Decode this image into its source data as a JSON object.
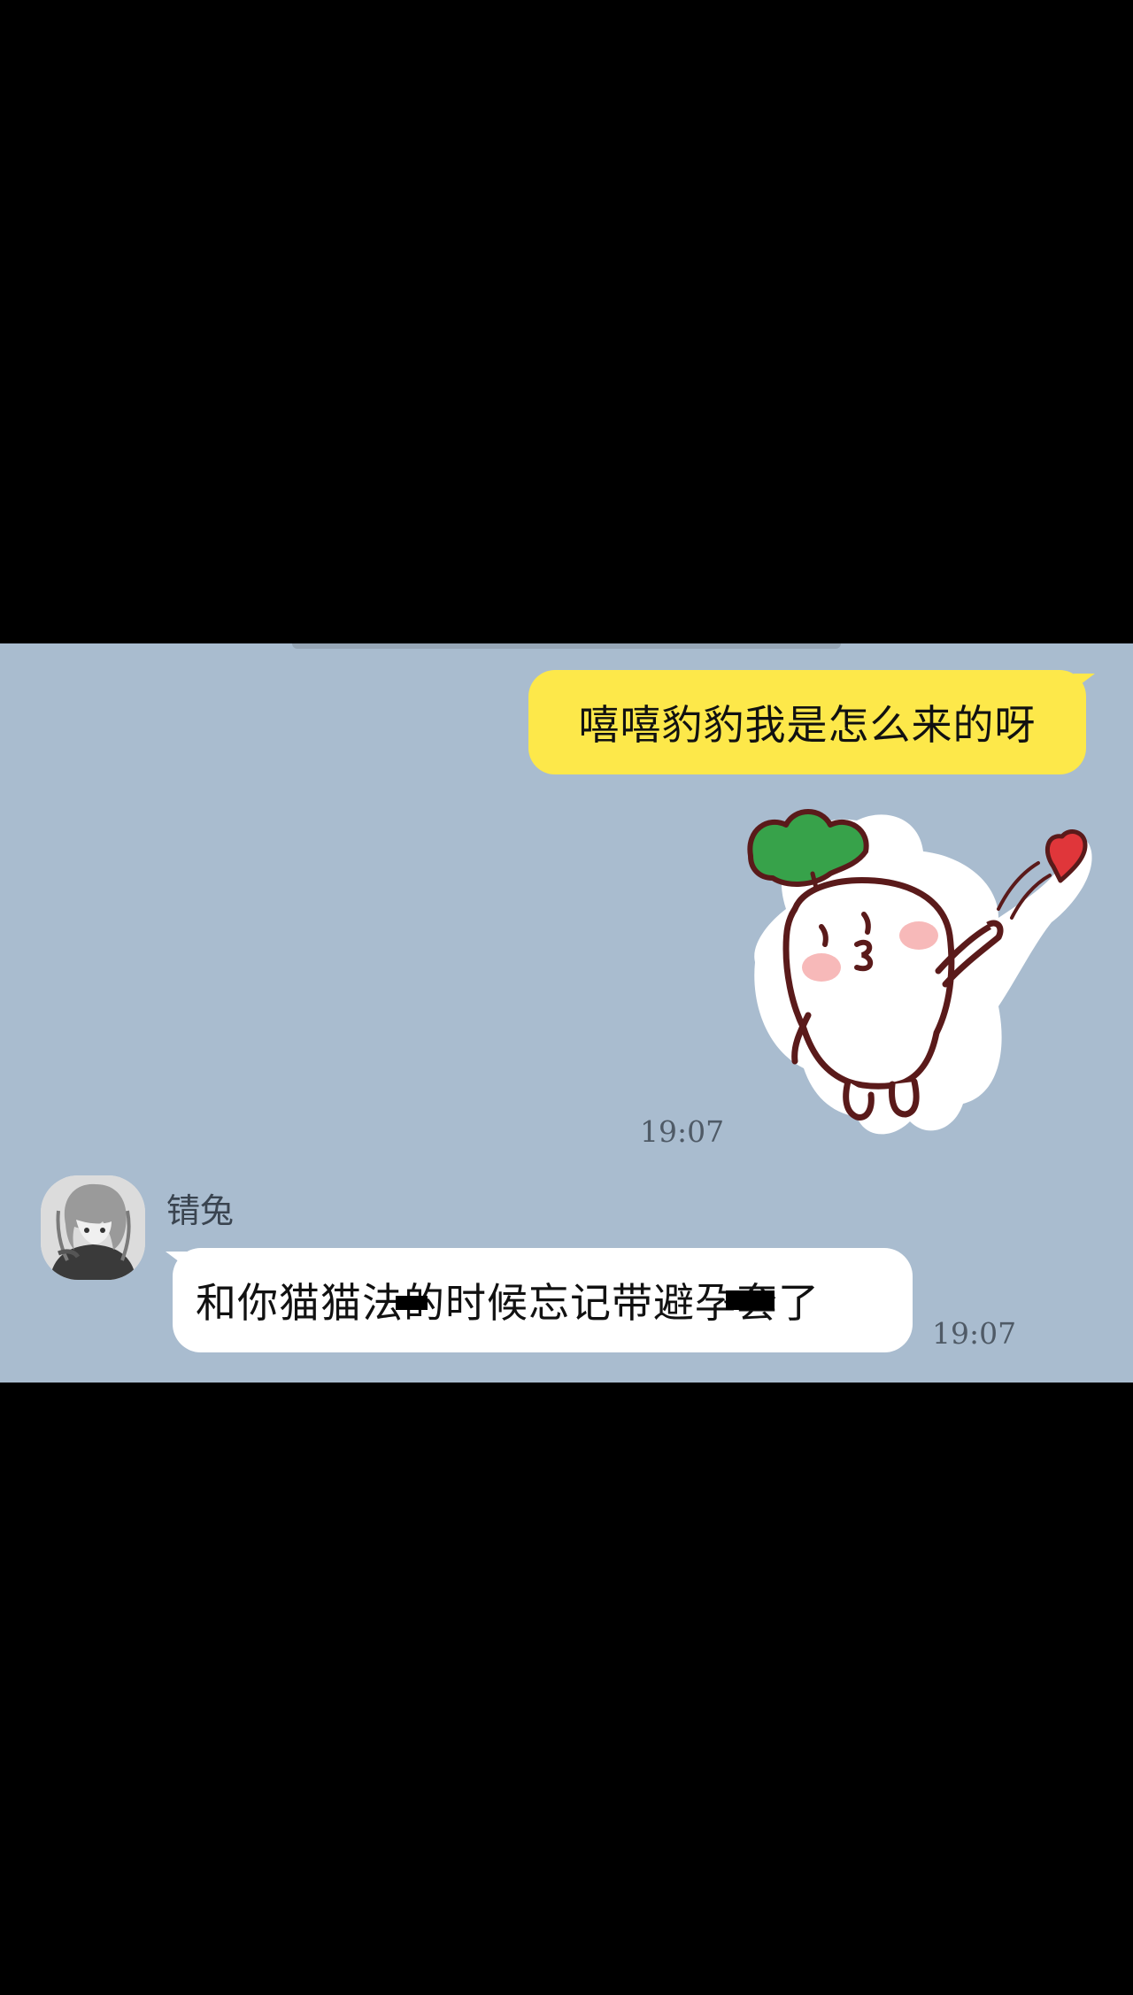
{
  "messages": [
    {
      "direction": "outgoing",
      "text": "嘻嘻豹豹我是怎么来的呀"
    },
    {
      "direction": "outgoing",
      "sticker": "radish-blowing-kiss-heart",
      "time": "19:07"
    },
    {
      "direction": "incoming",
      "sender": "锖兔",
      "text": "和你猫猫法的时候忘记带避孕套了",
      "time": "19:07"
    }
  ],
  "colors": {
    "chat_background": "#a9bccf",
    "outgoing_bubble": "#fde84a",
    "incoming_bubble": "#ffffff",
    "letterbox": "#000000"
  }
}
